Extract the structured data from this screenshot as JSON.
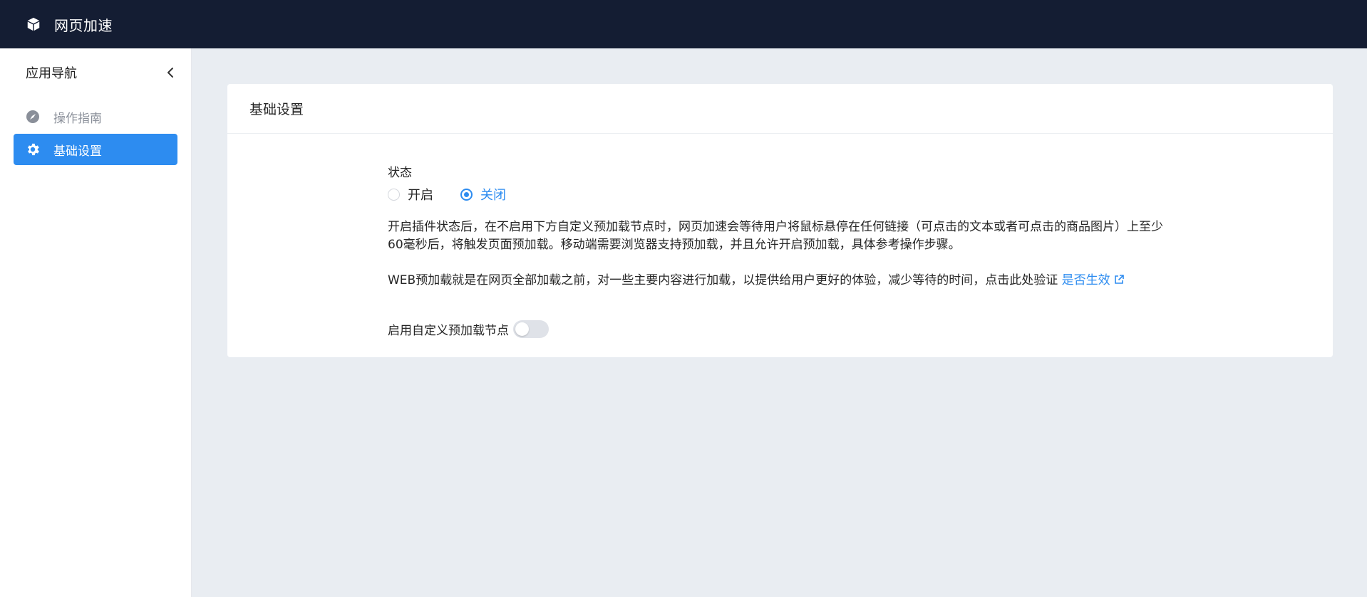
{
  "app": {
    "title": "网页加速",
    "logo_icon": "cube-icon"
  },
  "sidebar": {
    "title": "应用导航",
    "collapse_icon": "chevron-left-icon",
    "items": [
      {
        "label": "操作指南",
        "icon": "compass-icon",
        "active": false
      },
      {
        "label": "基础设置",
        "icon": "gear-icon",
        "active": true
      }
    ]
  },
  "card": {
    "title": "基础设置",
    "status_label": "状态",
    "radio_options": [
      {
        "label": "开启",
        "checked": false
      },
      {
        "label": "关闭",
        "checked": true
      }
    ],
    "description_1": "开启插件状态后，在不启用下方自定义预加载节点时，网页加速会等待用户将鼠标悬停在任何链接（可点击的文本或者可点击的商品图片）上至少60毫秒后，将触发页面预加载。移动端需要浏览器支持预加载，并且允许开启预加载，具体参考操作步骤。",
    "description_2": "WEB预加载就是在网页全部加载之前，对一些主要内容进行加载，以提供给用户更好的体验，减少等待的时间，点击此处验证",
    "verify_link": "是否生效",
    "custom_node_label": "启用自定义预加载节点",
    "custom_node_enabled": false
  },
  "colors": {
    "topbar": "#141d33",
    "accent": "#2d8cf0",
    "page_bg": "#e9edf2"
  }
}
